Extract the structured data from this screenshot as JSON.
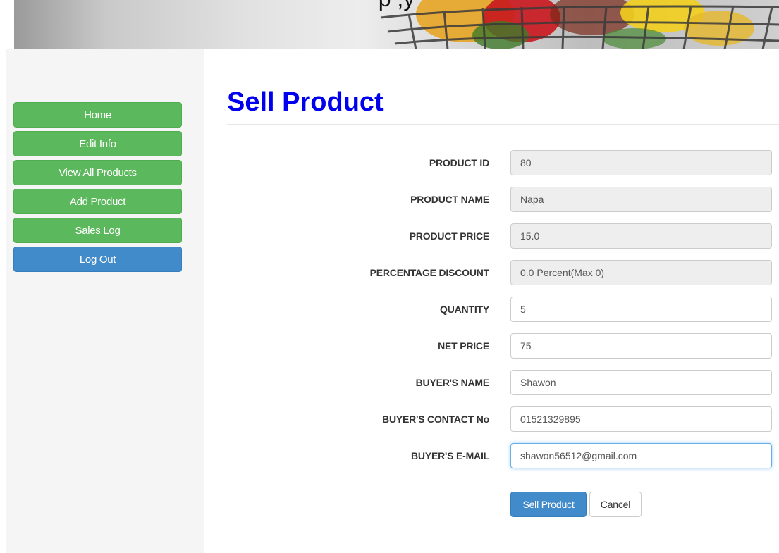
{
  "banner": {
    "caption": "p   ,y"
  },
  "sidebar": {
    "items": [
      {
        "label": "Home",
        "color": "#5cb85c"
      },
      {
        "label": "Edit Info",
        "color": "#5cb85c"
      },
      {
        "label": "View All Products",
        "color": "#5cb85c"
      },
      {
        "label": "Add Product",
        "color": "#5cb85c"
      },
      {
        "label": "Sales Log",
        "color": "#5cb85c"
      },
      {
        "label": "Log Out",
        "color": "#428bca"
      }
    ]
  },
  "main": {
    "title": "Sell Product",
    "title_color": "#0000ee",
    "fields": [
      {
        "label": "PRODUCT ID",
        "value": "80",
        "readonly": true
      },
      {
        "label": "PRODUCT NAME",
        "value": "Napa",
        "readonly": true
      },
      {
        "label": "PRODUCT PRICE",
        "value": "15.0",
        "readonly": true
      },
      {
        "label": "PERCENTAGE DISCOUNT",
        "value": "0.0 Percent(Max 0)",
        "readonly": true
      },
      {
        "label": "QUANTITY",
        "value": "5",
        "readonly": false
      },
      {
        "label": "NET PRICE",
        "value": "75",
        "readonly": false
      },
      {
        "label": "BUYER'S NAME",
        "value": "Shawon",
        "readonly": false
      },
      {
        "label": "BUYER'S CONTACT No",
        "value": "01521329895",
        "readonly": false
      },
      {
        "label": "BUYER'S E-MAIL",
        "value": "shawon56512@gmail.com",
        "readonly": false,
        "focused": true
      }
    ],
    "buttons": {
      "submit_label": "Sell Product",
      "cancel_label": "Cancel"
    }
  }
}
